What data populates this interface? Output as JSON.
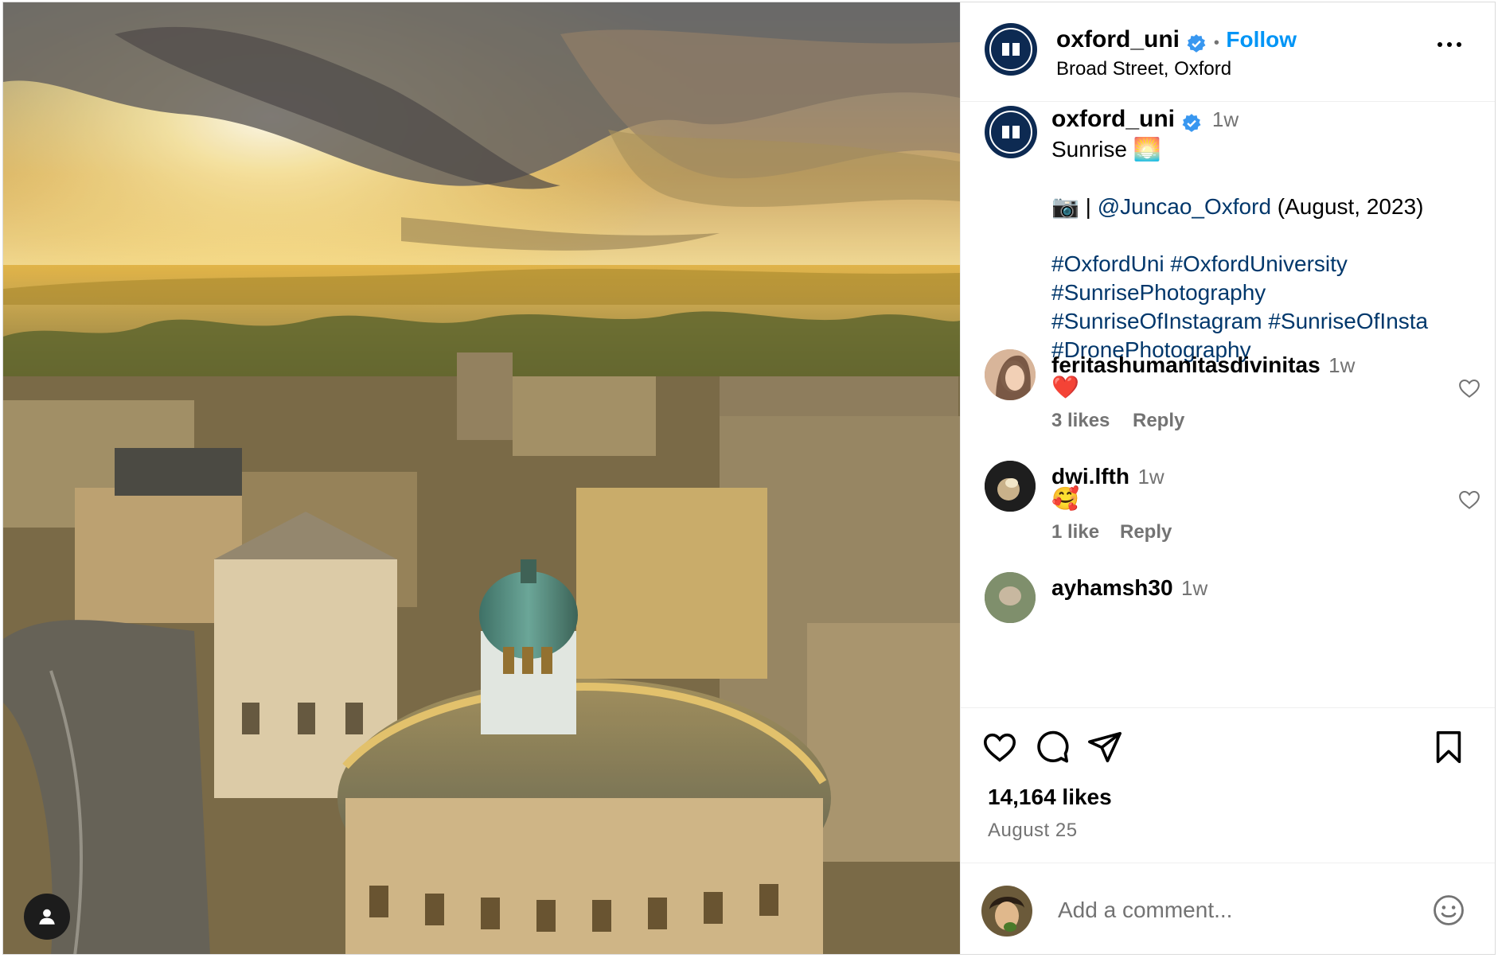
{
  "header": {
    "username": "oxford_uni",
    "follow_label": "Follow",
    "separator": "•",
    "location": "Broad Street, Oxford"
  },
  "caption": {
    "username": "oxford_uni",
    "time": "1w",
    "line1": "Sunrise 🌅",
    "credit_prefix": "📷 | ",
    "credit_mention": "@Juncao_Oxford",
    "credit_suffix": " (August, 2023)",
    "hashtag_lines": [
      "#OxfordUni #OxfordUniversity",
      "#SunrisePhotography",
      "#SunriseOfInstagram #SunriseOfInsta",
      "#DronePhotography"
    ]
  },
  "comments": [
    {
      "username": "feritashumanitasdivinitas",
      "time": "1w",
      "text": "❤️",
      "likes": "3 likes",
      "reply": "Reply"
    },
    {
      "username": "dwi.lfth",
      "time": "1w",
      "text": "🥰",
      "likes": "1 like",
      "reply": "Reply"
    },
    {
      "username": "ayhamsh30",
      "time": "1w"
    }
  ],
  "post": {
    "likes": "14,164 likes",
    "date": "August 25"
  },
  "comment_box": {
    "placeholder": "Add a comment..."
  },
  "colors": {
    "link_blue": "#0095f6",
    "hashtag": "#00376b",
    "secondary": "#737373",
    "verified": "#3897f0"
  }
}
